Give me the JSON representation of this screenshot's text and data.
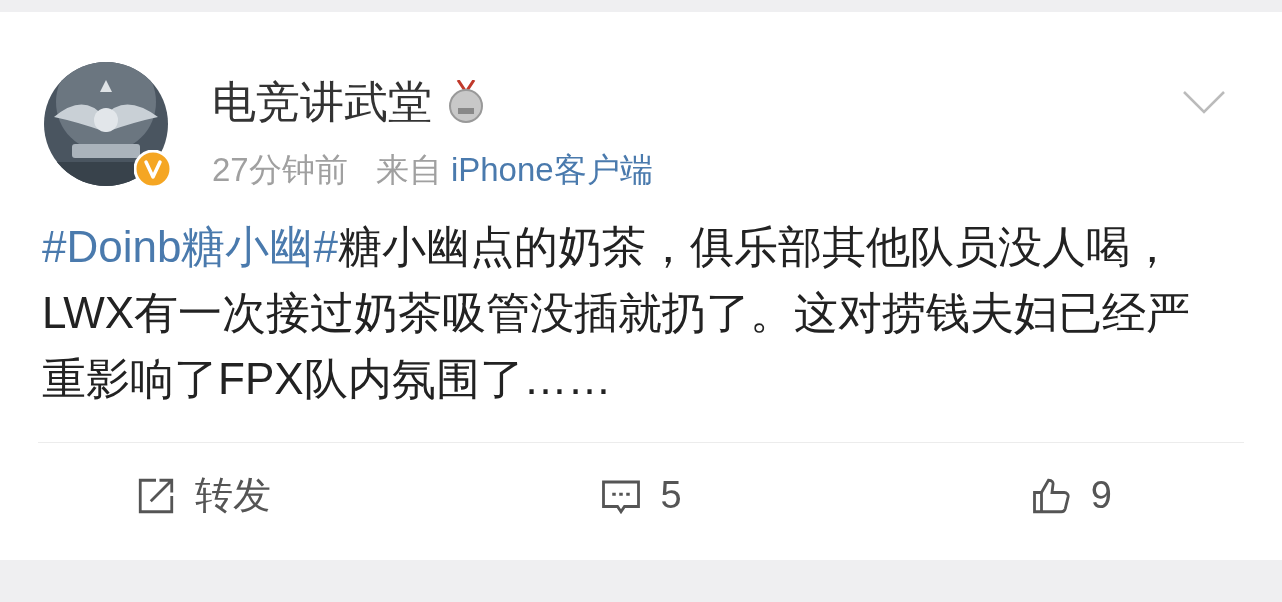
{
  "post": {
    "author": "电竞讲武堂",
    "time": "27分钟前",
    "source_prefix": "来自",
    "source": "iPhone客户端",
    "verified": true,
    "hashtag": "#Doinb糖小幽#",
    "text": "糖小幽点的奶茶，俱乐部其他队员没人喝，LWX有一次接过奶茶吸管没插就扔了。这对捞钱夫妇已经严重影响了FPX队内氛围了……"
  },
  "actions": [
    {
      "kind": "repost",
      "label": "转发"
    },
    {
      "kind": "comment",
      "label": "5"
    },
    {
      "kind": "like",
      "label": "9"
    }
  ]
}
